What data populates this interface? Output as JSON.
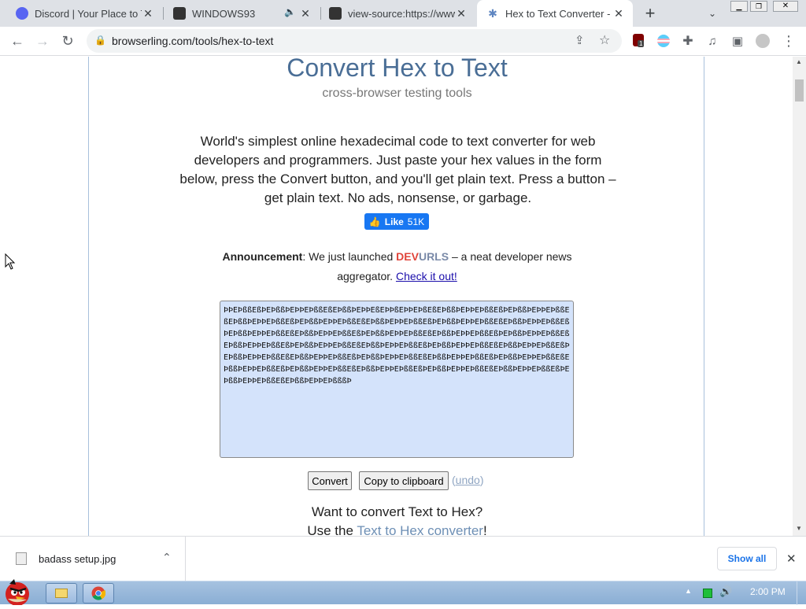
{
  "browser": {
    "tabs": [
      {
        "title": "Discord | Your Place to Ta",
        "favicon": "discord-icon",
        "color": "#5865f2"
      },
      {
        "title": "WINDOWS93",
        "favicon": "windows93-icon",
        "color": "#222222"
      },
      {
        "title": "view-source:https://www",
        "favicon": "windows93-icon",
        "color": "#222222"
      },
      {
        "title": "Hex to Text Converter - T",
        "favicon": "browserling-icon",
        "color": "#5f86c1"
      }
    ],
    "url": "browserling.com/tools/hex-to-text",
    "extension_badge": "1"
  },
  "page": {
    "title": "Convert Hex to Text",
    "subtitle": "cross-browser testing tools",
    "intro": "World's simplest online hexadecimal code to text converter for web developers and programmers. Just paste your hex values in the form below, press the Convert button, and you'll get plain text. Press a button – get plain text. No ads, nonsense, or garbage.",
    "like_label": "Like",
    "like_count": "51K",
    "announcement": {
      "label": "Announcement",
      "text_before": ": We just launched ",
      "dev": "DEV",
      "urls": "URLS",
      "text_after": " – a neat developer news aggregator. ",
      "link": "Check it out!"
    },
    "textarea_value": "ÞÞEÞßßEßÞEÞßßÞEÞÞEÞßßEßEÞßßÞEÞÞEßEÞÞßEÞÞEÞßEßEÞßßÞEÞÞEÞßßEßÞEÞßßÞEÞÞEÞßßEßEÞßßÞEÞÞEÞßßEßÞEÞßßÞEÞÞEÞßßEßEÞßßÞEÞÞEÞßßEßÞEÞßßÞEÞÞEÞßßEßEÞßßÞEÞÞEÞßßEßÞEÞßßÞEÞÞEÞßßEßEÞßßÞEÞÞEÞßßEßÞEÞßßÞEÞÞEÞßßEßEÞßßÞEÞÞEÞßßEßÞEÞßßÞEÞÞEÞßßEßEÞßßÞEÞÞEÞßßEßÞEÞßßÞEÞÞEÞßßEßEÞßßÞEÞÞEÞßßEßÞEÞßßÞEÞÞEÞßßEßEÞßßÞEÞÞEÞßßEßÞEÞßßÞEÞÞEÞßßEßEÞßßÞEÞÞEÞßßEßÞEÞßßÞEÞÞEÞßßEßEÞßßÞEÞÞEÞßßEßÞEÞßßÞEÞÞEÞßßEßEÞßßÞEÞÞEÞßßEßÞEÞßßÞEÞÞEÞßßEßEÞßßÞEÞÞEÞßßEßÞEÞßßÞEÞÞEÞßßEßEÞßßÞEÞÞEÞßßEßÞEÞßßÞEÞÞEÞßßEßEÞßßÞEÞÞEÞßßßÞ",
    "convert_label": "Convert",
    "copy_label": "Copy to clipboard",
    "undo_label": "undo",
    "want_text": "Want to convert Text to Hex?",
    "use_prefix": "Use the ",
    "use_link": "Text to Hex converter",
    "use_suffix": "!"
  },
  "download": {
    "filename": "badass setup.jpg",
    "show_all": "Show all"
  },
  "taskbar": {
    "time": "2:00 PM"
  }
}
